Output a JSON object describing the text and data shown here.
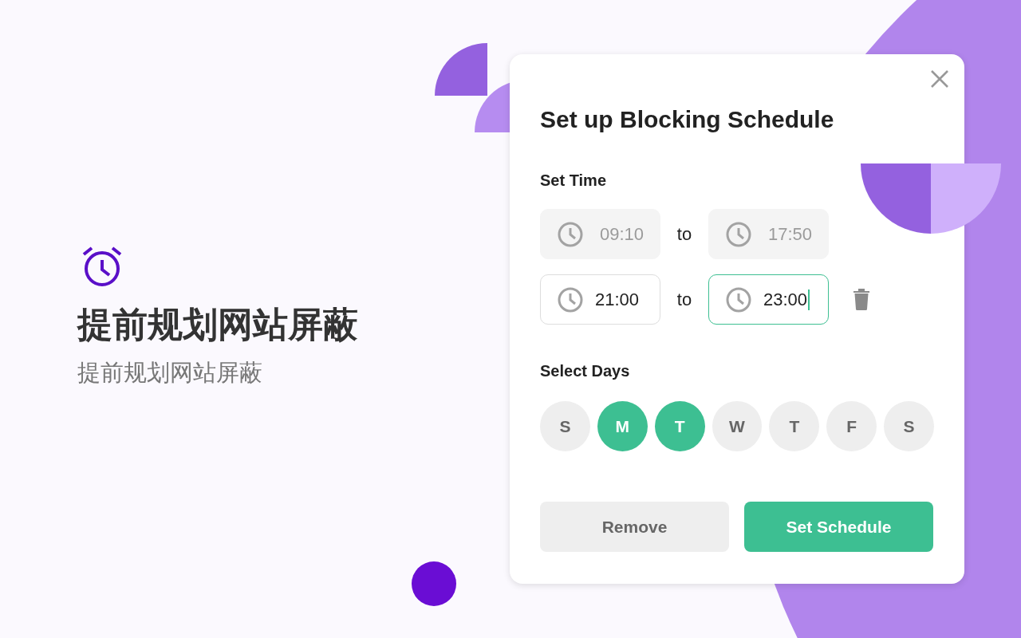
{
  "hero": {
    "title": "提前规划网站屏蔽",
    "subtitle": "提前规划网站屏蔽"
  },
  "dialog": {
    "title": "Set up Blocking Schedule",
    "time_heading": "Set Time",
    "time_rows": [
      {
        "disabled": true,
        "deletable": false,
        "start": {
          "value": "09:10",
          "focused": false
        },
        "separator": "to",
        "end": {
          "value": "17:50",
          "focused": false
        }
      },
      {
        "disabled": false,
        "deletable": true,
        "start": {
          "value": "21:00",
          "focused": false
        },
        "separator": "to",
        "end": {
          "value": "23:00",
          "focused": true
        }
      }
    ],
    "days_heading": "Select Days",
    "days": [
      {
        "label": "S",
        "selected": false
      },
      {
        "label": "M",
        "selected": true
      },
      {
        "label": "T",
        "selected": true
      },
      {
        "label": "W",
        "selected": false
      },
      {
        "label": "T",
        "selected": false
      },
      {
        "label": "F",
        "selected": false
      },
      {
        "label": "S",
        "selected": false
      }
    ],
    "buttons": [
      {
        "label": "Remove",
        "kind": "secondary"
      },
      {
        "label": "Set Schedule",
        "kind": "primary"
      }
    ]
  }
}
